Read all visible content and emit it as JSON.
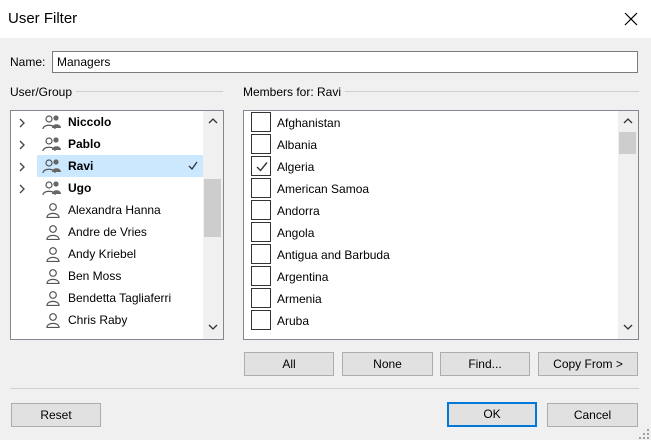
{
  "window": {
    "title": "User Filter"
  },
  "name_field": {
    "label": "Name:",
    "value": "Managers"
  },
  "user_group": {
    "label": "User/Group",
    "items": [
      {
        "label": "Niccolo",
        "type": "group",
        "bold": true,
        "selected": false,
        "checked": false
      },
      {
        "label": "Pablo",
        "type": "group",
        "bold": true,
        "selected": false,
        "checked": false
      },
      {
        "label": "Ravi",
        "type": "group",
        "bold": true,
        "selected": true,
        "checked": true
      },
      {
        "label": "Ugo",
        "type": "group",
        "bold": true,
        "selected": false,
        "checked": false
      },
      {
        "label": "Alexandra Hanna",
        "type": "user",
        "bold": false,
        "selected": false,
        "checked": false
      },
      {
        "label": "Andre de Vries",
        "type": "user",
        "bold": false,
        "selected": false,
        "checked": false
      },
      {
        "label": "Andy Kriebel",
        "type": "user",
        "bold": false,
        "selected": false,
        "checked": false
      },
      {
        "label": "Ben Moss",
        "type": "user",
        "bold": false,
        "selected": false,
        "checked": false
      },
      {
        "label": "Bendetta Tagliaferri",
        "type": "user",
        "bold": false,
        "selected": false,
        "checked": false
      },
      {
        "label": "Chris Raby",
        "type": "user",
        "bold": false,
        "selected": false,
        "checked": false
      }
    ]
  },
  "members": {
    "label": "Members for: Ravi",
    "items": [
      {
        "label": "Afghanistan",
        "checked": false
      },
      {
        "label": "Albania",
        "checked": false
      },
      {
        "label": "Algeria",
        "checked": true
      },
      {
        "label": "American Samoa",
        "checked": false
      },
      {
        "label": "Andorra",
        "checked": false
      },
      {
        "label": "Angola",
        "checked": false
      },
      {
        "label": "Antigua and Barbuda",
        "checked": false
      },
      {
        "label": "Argentina",
        "checked": false
      },
      {
        "label": "Armenia",
        "checked": false
      },
      {
        "label": "Aruba",
        "checked": false
      }
    ]
  },
  "member_buttons": {
    "all": "All",
    "none": "None",
    "find": "Find...",
    "copy_from": "Copy From >"
  },
  "footer": {
    "reset": "Reset",
    "ok": "OK",
    "cancel": "Cancel"
  },
  "colors": {
    "accent": "#0078d7",
    "selection": "#cce8ff"
  },
  "icons": {
    "close": "close-icon",
    "group": "group-icon",
    "user": "user-icon",
    "expand": "chevron-right-icon",
    "check": "check-icon"
  }
}
